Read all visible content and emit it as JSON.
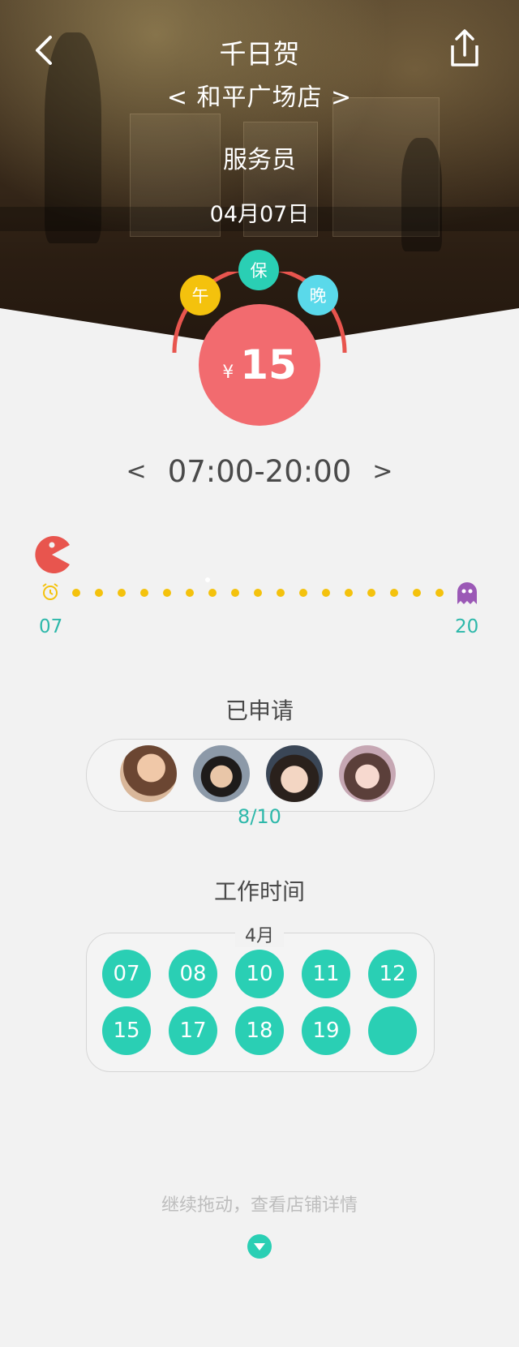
{
  "header": {
    "title": "千日贺",
    "store": "< 和平广场店 >",
    "role": "服务员",
    "date": "04月07日"
  },
  "wage": {
    "currency": "¥",
    "amount": "15",
    "badges": {
      "noon": "午",
      "full": "保",
      "evening": "晚"
    }
  },
  "time_range": {
    "prev": "<",
    "value": "07:00-20:00",
    "next": ">"
  },
  "timeline": {
    "start": "07",
    "end": "20"
  },
  "applied": {
    "title": "已申请",
    "count": "8/10"
  },
  "work_time": {
    "title": "工作时间",
    "month": "4月",
    "days": [
      "07",
      "08",
      "10",
      "11",
      "12",
      "15",
      "17",
      "18",
      "19",
      ""
    ]
  },
  "footer": {
    "hint": "继续拖动，查看店铺详情"
  },
  "colors": {
    "teal": "#2acfb4",
    "coral": "#f26b6f",
    "yellow": "#f4c20d",
    "cyan": "#5ad9ea",
    "purple": "#9b59b6"
  },
  "icons": [
    "back-icon",
    "share-icon",
    "pacman-icon",
    "alarm-icon",
    "ghost-icon",
    "chevron-down-icon"
  ]
}
